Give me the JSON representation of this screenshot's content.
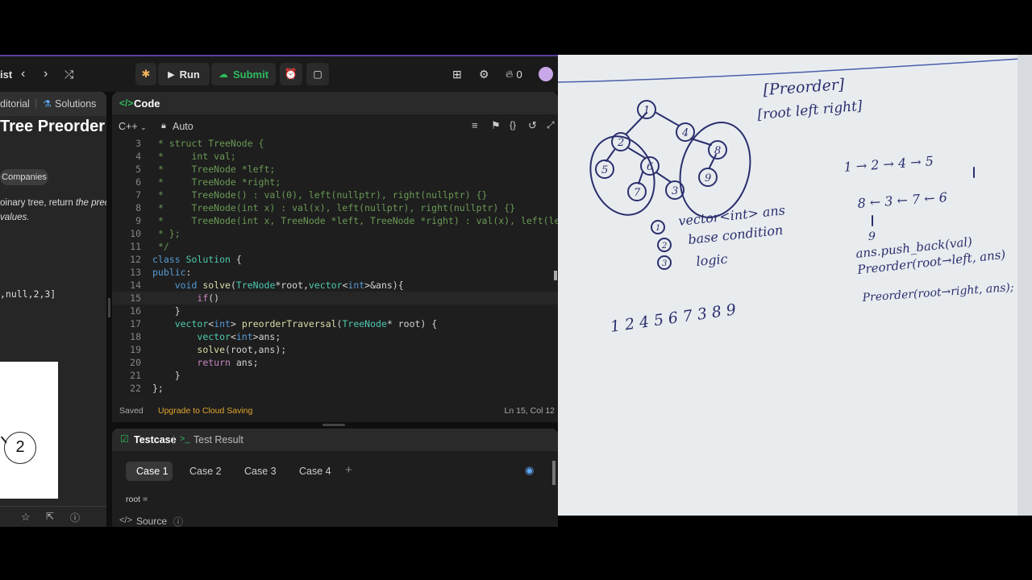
{
  "topbar": {
    "nav_label": "ist",
    "run_label": "Run",
    "submit_label": "Submit",
    "streak_count": "0"
  },
  "left_panel": {
    "tabs": [
      "ditorial",
      "Solutions"
    ],
    "title": "Tree Preorder",
    "companies_label": "Companies",
    "desc_line1": "oinary tree, return ",
    "desc_em": "the prec",
    "desc_line2": "values.",
    "example_input": ",null,2,3]",
    "node_label": "2"
  },
  "code_panel": {
    "header": "Code",
    "language": "C++",
    "mode": "Auto",
    "lines": [
      {
        "n": "3",
        "html": "<span class='cm'> * struct TreeNode {</span>"
      },
      {
        "n": "4",
        "html": "<span class='cm'> *     int val;</span>"
      },
      {
        "n": "5",
        "html": "<span class='cm'> *     TreeNode *left;</span>"
      },
      {
        "n": "6",
        "html": "<span class='cm'> *     TreeNode *right;</span>"
      },
      {
        "n": "7",
        "html": "<span class='cm'> *     TreeNode() : val(0), left(nullptr), right(nullptr) {}</span>"
      },
      {
        "n": "8",
        "html": "<span class='cm'> *     TreeNode(int x) : val(x), left(nullptr), right(nullptr) {}</span>"
      },
      {
        "n": "9",
        "html": "<span class='cm'> *     TreeNode(int x, TreeNode *left, TreeNode *right) : val(x), left(left), right(right) {}</span>"
      },
      {
        "n": "10",
        "html": "<span class='cm'> * };</span>"
      },
      {
        "n": "11",
        "html": "<span class='cm'> */</span>"
      },
      {
        "n": "12",
        "html": "<span class='kw'>class</span> <span class='ty'>Solution</span> <span class='tx'>{</span>"
      },
      {
        "n": "13",
        "html": "<span class='kw'>public</span><span class='tx'>:</span>"
      },
      {
        "n": "14",
        "html": "    <span class='kw'>void</span> <span class='fn'>solve</span><span class='tx'>(</span><span class='ty'>TreNode</span><span class='tx'>*root,</span><span class='ty'>vector</span><span class='tx'>&lt;</span><span class='kw'>int</span><span class='tx'>&gt;&amp;ans){</span>"
      },
      {
        "n": "15",
        "html": "        <span class='pk'>if</span><span class='tx'>()</span>"
      },
      {
        "n": "16",
        "html": "    <span class='tx'>}</span>"
      },
      {
        "n": "17",
        "html": "    <span class='ty'>vector</span><span class='tx'>&lt;</span><span class='kw'>int</span><span class='tx'>&gt;</span> <span class='fn'>preorderTraversal</span><span class='tx'>(</span><span class='ty'>TreeNode</span><span class='tx'>* root) {</span>"
      },
      {
        "n": "18",
        "html": "        <span class='ty'>vector</span><span class='tx'>&lt;</span><span class='kw'>int</span><span class='tx'>&gt;ans;</span>"
      },
      {
        "n": "19",
        "html": "        <span class='fn'>solve</span><span class='tx'>(root,ans);</span>"
      },
      {
        "n": "20",
        "html": "        <span class='pk'>return</span> <span class='tx'>ans;</span>"
      },
      {
        "n": "21",
        "html": "    <span class='tx'>}</span>"
      },
      {
        "n": "22",
        "html": "<span class='tx'>};</span>"
      }
    ],
    "saved_label": "Saved",
    "upgrade_label": "Upgrade to Cloud Saving",
    "cursor_pos": "Ln 15, Col 12"
  },
  "test_panel": {
    "tab_testcase": "Testcase",
    "tab_result": "Test Result",
    "cases": [
      "Case 1",
      "Case 2",
      "Case 3",
      "Case 4"
    ],
    "root_label": "root =",
    "source_label": "Source"
  },
  "notes": {
    "title": "[Preorder]",
    "subtitle": "[root left right]",
    "tree_nodes": [
      "1",
      "2",
      "3",
      "4",
      "5",
      "6",
      "7",
      "8",
      "9"
    ],
    "steps": [
      "vector<int> ans",
      "base condition",
      "logic"
    ],
    "order": "1 2 4 5 6 7 3 8 9",
    "seq_top": "1 → 2 → 4 → 5",
    "seq_mid": "8 ← 3 ← 7 ← 6",
    "seq_bot": "9",
    "code1": "ans.push_back(val)",
    "code2": "Preorder(root→left, ans)",
    "code3": "Preorder(root→right, ans);"
  },
  "colors": {
    "accent_purple": "#5b3fa0",
    "submit_green": "#2cbb5d",
    "ink_blue": "#2a2f6e"
  }
}
